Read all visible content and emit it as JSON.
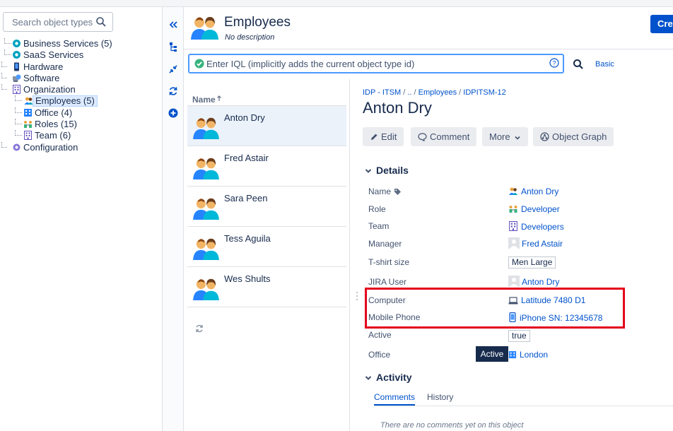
{
  "tree": {
    "search_placeholder": "Search object types",
    "items": [
      {
        "label": "Business Services (5)",
        "icon": "service-icon"
      },
      {
        "label": "SaaS Services",
        "icon": "service-icon"
      },
      {
        "label": "Hardware",
        "icon": "hardware-icon"
      },
      {
        "label": "Software",
        "icon": "software-icon"
      },
      {
        "label": "Organization",
        "icon": "organization-icon"
      },
      {
        "label": "Employees (5)",
        "icon": "employees-icon"
      },
      {
        "label": "Office (4)",
        "icon": "office-icon"
      },
      {
        "label": "Roles (15)",
        "icon": "roles-icon"
      },
      {
        "label": "Team (6)",
        "icon": "team-icon"
      },
      {
        "label": "Configuration",
        "icon": "configuration-icon"
      }
    ]
  },
  "header": {
    "title": "Employees",
    "description": "No description",
    "create_label": "Crea"
  },
  "iql": {
    "placeholder": "Enter IQL (implicitly adds the current object type id)",
    "basic_label": "Basic"
  },
  "list": {
    "column_header": "Name",
    "items": [
      "Anton Dry",
      "Fred Astair",
      "Sara Peen",
      "Tess Aguila",
      "Wes Shults"
    ]
  },
  "detail": {
    "breadcrumb": [
      "IDP - ITSM",
      "..",
      "Employees",
      "IDPITSM-12"
    ],
    "title": "Anton Dry",
    "buttons": {
      "edit": "Edit",
      "comment": "Comment",
      "more": "More",
      "graph": "Object Graph"
    },
    "details_heading": "Details",
    "attributes": [
      {
        "label": "Name",
        "value": "Anton Dry"
      },
      {
        "label": "Role",
        "value": "Developer"
      },
      {
        "label": "Team",
        "value": "Developers"
      },
      {
        "label": "Manager",
        "value": "Fred Astair"
      },
      {
        "label": "T-shirt size",
        "value": "Men Large"
      },
      {
        "label": "JIRA User",
        "value": "Anton Dry"
      },
      {
        "label": "Computer",
        "value": "Latitude 7480 D1"
      },
      {
        "label": "Mobile Phone",
        "value": "iPhone SN: 12345678"
      },
      {
        "label": "Active",
        "value": "true"
      },
      {
        "label": "Office",
        "value": "London"
      }
    ],
    "tooltip": "Active",
    "activity_heading": "Activity",
    "tabs": [
      "Comments",
      "History"
    ],
    "no_comments": "There are no comments yet on this object"
  },
  "colors": {
    "accent": "#0052cc",
    "highlight": "#e3001b",
    "iql_border": "#4c9aff"
  }
}
